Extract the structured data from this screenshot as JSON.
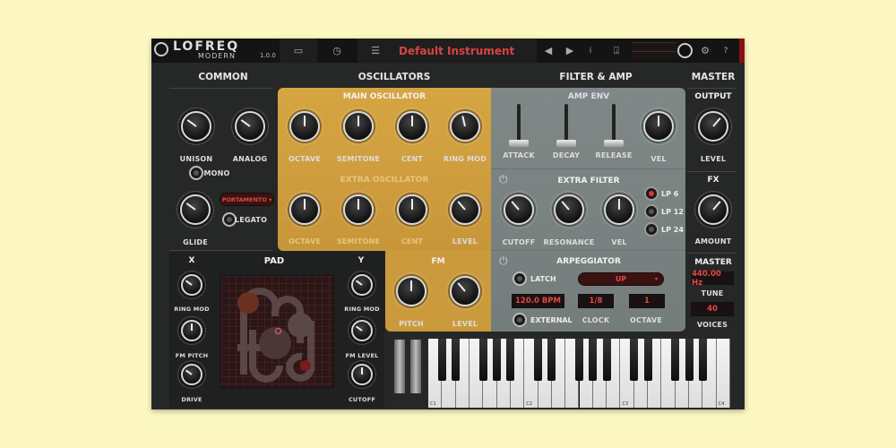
{
  "topbar": {
    "logo_line1": "LOFREQ",
    "logo_line2": "MODERN",
    "version": "1.0.0",
    "instrument_name": "Default Instrument",
    "info_label": "i",
    "help_label": "?",
    "icons": [
      "folder-icon",
      "clock-icon",
      "sliders-icon",
      "prev-icon",
      "next-icon",
      "info-icon",
      "save-icon",
      "gear-icon",
      "help-icon"
    ]
  },
  "sections": {
    "common": "COMMON",
    "oscillators": "OSCILLATORS",
    "filter_amp": "FILTER & AMP",
    "master": "MASTER"
  },
  "common": {
    "unison": {
      "label": "UNISON",
      "value": 0.3
    },
    "analog": {
      "label": "ANALOG",
      "value": 0.3
    },
    "mono": "MONO",
    "glide": {
      "label": "GLIDE",
      "value": 0.3
    },
    "glide_mode": "PORTAMENTO ▾",
    "legato": "LEGATO"
  },
  "main_osc": {
    "title": "MAIN OSCILLATOR",
    "knobs": [
      {
        "label": "OCTAVE",
        "value": 0.5
      },
      {
        "label": "SEMITONE",
        "value": 0.5
      },
      {
        "label": "CENT",
        "value": 0.5
      },
      {
        "label": "RING MOD",
        "value": 0.45
      }
    ]
  },
  "extra_osc": {
    "title": "EXTRA OSCILLATOR",
    "knobs": [
      {
        "label": "OCTAVE",
        "value": 0.5
      },
      {
        "label": "SEMITONE",
        "value": 0.5
      },
      {
        "label": "CENT",
        "value": 0.5
      },
      {
        "label": "LEVEL",
        "value": 0.35
      }
    ]
  },
  "fm": {
    "title": "FM",
    "knobs": [
      {
        "label": "PITCH",
        "value": 0.5
      },
      {
        "label": "LEVEL",
        "value": 0.35
      }
    ]
  },
  "amp_env": {
    "title": "AMP ENV",
    "sliders": [
      {
        "label": "ATTACK",
        "value": 0.0
      },
      {
        "label": "DECAY",
        "value": 0.0
      },
      {
        "label": "RELEASE",
        "value": 0.0
      }
    ],
    "vel": {
      "label": "VEL",
      "value": 0.5
    }
  },
  "extra_filter": {
    "title": "EXTRA FILTER",
    "knobs": [
      {
        "label": "CUTOFF",
        "value": 0.35
      },
      {
        "label": "RESONANCE",
        "value": 0.35
      },
      {
        "label": "VEL",
        "value": 0.5
      }
    ],
    "modes": [
      {
        "label": "LP 6",
        "selected": true
      },
      {
        "label": "LP 12",
        "selected": false
      },
      {
        "label": "LP 24",
        "selected": false
      }
    ]
  },
  "arp": {
    "title": "ARPEGGIATOR",
    "latch": "LATCH",
    "mode": "UP",
    "mode_arrow": "▾",
    "bpm": "120.0 BPM",
    "clock_value": "1/8",
    "clock_label": "CLOCK",
    "octave_value": "1",
    "octave_label": "OCTAVE",
    "external": "EXTERNAL"
  },
  "master": {
    "output": "OUTPUT",
    "level": {
      "label": "LEVEL",
      "value": 0.65
    },
    "fx": "FX",
    "amount": {
      "label": "AMOUNT",
      "value": 0.65
    },
    "master_label": "MASTER",
    "tune_value": "440.00 Hz",
    "tune_label": "TUNE",
    "voices_value": "40",
    "voices_label": "VOICES"
  },
  "pad": {
    "title": "PAD",
    "x": "X",
    "y": "Y",
    "x_knobs": [
      {
        "label": "RING MOD",
        "value": 0.3
      },
      {
        "label": "FM PITCH",
        "value": 0.5
      },
      {
        "label": "DRIVE",
        "value": 0.3
      }
    ],
    "y_knobs": [
      {
        "label": "RING MOD",
        "value": 0.3
      },
      {
        "label": "FM LEVEL",
        "value": 0.3
      },
      {
        "label": "CUTOFF",
        "value": 0.5
      }
    ]
  },
  "keyboard": {
    "octave_labels": [
      "C1",
      "C2",
      "C3",
      "C4"
    ]
  },
  "colors": {
    "orange": "#d4a23c",
    "grey_panel": "#7d8685",
    "accent_red": "#e04848"
  }
}
